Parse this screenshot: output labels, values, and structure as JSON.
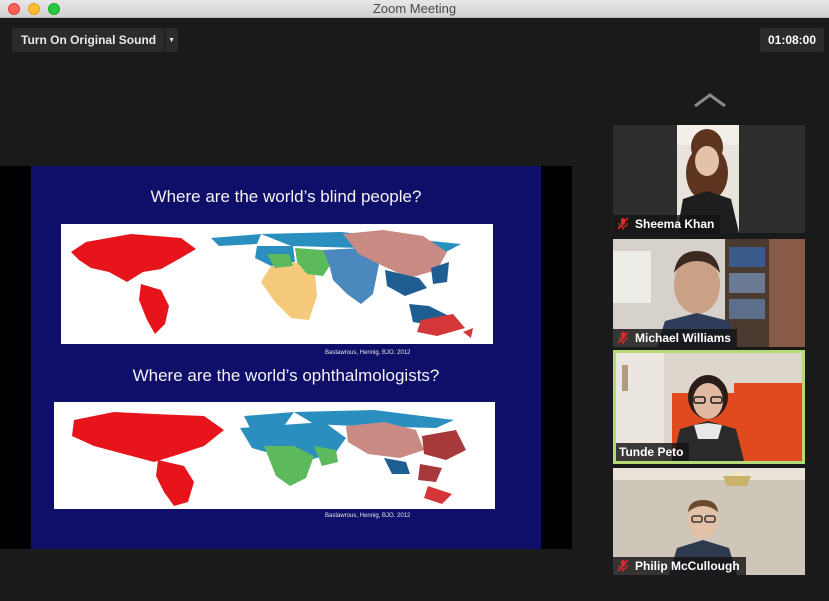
{
  "window": {
    "title": "Zoom Meeting"
  },
  "toolbar": {
    "original_sound_label": "Turn On Original Sound",
    "timer": "01:08:00"
  },
  "share": {
    "slide": {
      "title1": "Where are the world’s blind people?",
      "title2": "Where are the world’s ophthalmologists?",
      "citation1": "Bastawrous, Hennig, BJO. 2012",
      "citation2": "Bastawrous, Hennig, BJO. 2012"
    }
  },
  "participants": [
    {
      "name": "Sheema Khan",
      "muted": true,
      "active_speaker": false
    },
    {
      "name": "Michael Williams",
      "muted": true,
      "active_speaker": false
    },
    {
      "name": "Tunde Peto",
      "muted": false,
      "active_speaker": true
    },
    {
      "name": "Philip McCullough",
      "muted": true,
      "active_speaker": false
    }
  ],
  "colors": {
    "active_speaker_border": "#b5d977",
    "muted_icon": "#e02828"
  }
}
